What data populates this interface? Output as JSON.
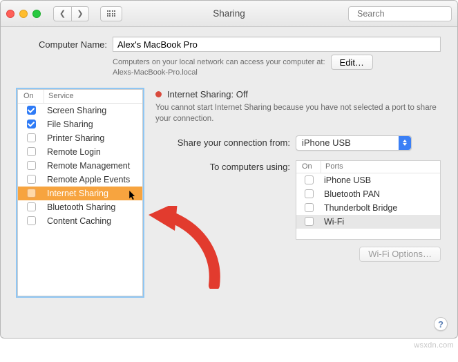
{
  "window": {
    "title": "Sharing",
    "search_placeholder": "Search"
  },
  "computer_name": {
    "label": "Computer Name:",
    "value": "Alex's MacBook Pro",
    "hint_line1": "Computers on your local network can access your computer at:",
    "hint_line2": "Alexs-MacBook-Pro.local",
    "edit_button": "Edit…"
  },
  "services": {
    "header_on": "On",
    "header_service": "Service",
    "items": [
      {
        "label": "Screen Sharing",
        "on": true,
        "selected": false
      },
      {
        "label": "File Sharing",
        "on": true,
        "selected": false
      },
      {
        "label": "Printer Sharing",
        "on": false,
        "selected": false
      },
      {
        "label": "Remote Login",
        "on": false,
        "selected": false
      },
      {
        "label": "Remote Management",
        "on": false,
        "selected": false
      },
      {
        "label": "Remote Apple Events",
        "on": false,
        "selected": false
      },
      {
        "label": "Internet Sharing",
        "on": false,
        "selected": true
      },
      {
        "label": "Bluetooth Sharing",
        "on": false,
        "selected": false
      },
      {
        "label": "Content Caching",
        "on": false,
        "selected": false
      }
    ]
  },
  "detail": {
    "status_title": "Internet Sharing: Off",
    "status_desc": "You cannot start Internet Sharing because you have not selected a port to share your connection.",
    "share_from_label": "Share your connection from:",
    "share_from_value": "iPhone USB",
    "to_computers_label": "To computers using:",
    "ports_header_on": "On",
    "ports_header_ports": "Ports",
    "ports": [
      {
        "label": "iPhone USB",
        "on": false,
        "hl": false
      },
      {
        "label": "Bluetooth PAN",
        "on": false,
        "hl": false
      },
      {
        "label": "Thunderbolt Bridge",
        "on": false,
        "hl": false
      },
      {
        "label": "Wi-Fi",
        "on": false,
        "hl": true
      }
    ],
    "wifi_options_button": "Wi-Fi Options…"
  },
  "help_label": "?",
  "watermark": "wsxdn.com"
}
